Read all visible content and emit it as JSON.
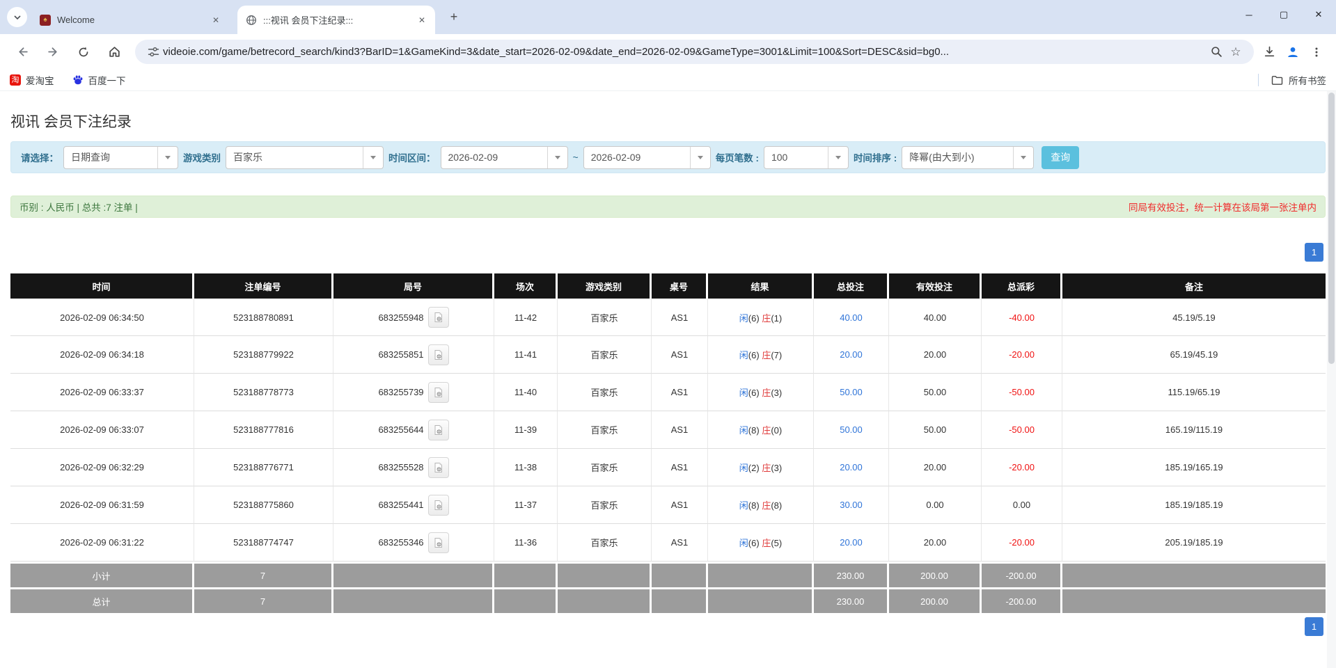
{
  "browser": {
    "tabs": [
      {
        "title": "Welcome",
        "close_glyph": "✕"
      },
      {
        "title": ":::视讯 会员下注纪录:::",
        "close_glyph": "✕"
      }
    ],
    "new_tab_glyph": "+",
    "window_controls": {
      "minimize": "─",
      "maximize": "▢",
      "close": "✕"
    },
    "url": "videoie.com/game/betrecord_search/kind3?BarID=1&GameKind=3&date_start=2026-02-09&date_end=2026-02-09&GameType=3001&Limit=100&Sort=DESC&sid=bg0...",
    "bookmarks": [
      {
        "label": "爱淘宝",
        "icon_text": "淘"
      },
      {
        "label": "百度一下"
      }
    ],
    "bookmarks_right_label": "所有书签"
  },
  "page": {
    "title": "视讯 会员下注纪录",
    "filters": {
      "select_label": "请选择：",
      "select_value": "日期查询",
      "game_label": "游戏类别",
      "game_value": "百家乐",
      "range_label": "时间区间：",
      "date_start": "2026-02-09",
      "tilde": "~",
      "date_end": "2026-02-09",
      "per_page_label": "每页笔数 :",
      "per_page_value": "100",
      "sort_label": "时间排序 :",
      "sort_value": "降幂(由大到小)",
      "search_button": "查询"
    },
    "summary": {
      "left": "币别 : 人民币 | 总共 :7 注单 |",
      "right": "同局有效投注，统一计算在该局第一张注单内"
    },
    "pagination_label": "1",
    "table": {
      "headers": [
        "时间",
        "注单编号",
        "局号",
        "场次",
        "游戏类别",
        "桌号",
        "结果",
        "总投注",
        "有效投注",
        "总派彩",
        "备注"
      ],
      "rows": [
        {
          "time": "2026-02-09 06:34:50",
          "bet_no": "523188780891",
          "round_no": "683255948",
          "session": "11-42",
          "game": "百家乐",
          "table_no": "AS1",
          "result": {
            "player_label": "闲",
            "player_score": "(6)",
            "banker_label": "庄",
            "banker_score": "(1)"
          },
          "total_bet": "40.00",
          "valid_bet": "40.00",
          "payout": "-40.00",
          "payout_neg": true,
          "note": "45.19/5.19"
        },
        {
          "time": "2026-02-09 06:34:18",
          "bet_no": "523188779922",
          "round_no": "683255851",
          "session": "11-41",
          "game": "百家乐",
          "table_no": "AS1",
          "result": {
            "player_label": "闲",
            "player_score": "(6)",
            "banker_label": "庄",
            "banker_score": "(7)"
          },
          "total_bet": "20.00",
          "valid_bet": "20.00",
          "payout": "-20.00",
          "payout_neg": true,
          "note": "65.19/45.19"
        },
        {
          "time": "2026-02-09 06:33:37",
          "bet_no": "523188778773",
          "round_no": "683255739",
          "session": "11-40",
          "game": "百家乐",
          "table_no": "AS1",
          "result": {
            "player_label": "闲",
            "player_score": "(6)",
            "banker_label": "庄",
            "banker_score": "(3)"
          },
          "total_bet": "50.00",
          "valid_bet": "50.00",
          "payout": "-50.00",
          "payout_neg": true,
          "note": "115.19/65.19"
        },
        {
          "time": "2026-02-09 06:33:07",
          "bet_no": "523188777816",
          "round_no": "683255644",
          "session": "11-39",
          "game": "百家乐",
          "table_no": "AS1",
          "result": {
            "player_label": "闲",
            "player_score": "(8)",
            "banker_label": "庄",
            "banker_score": "(0)"
          },
          "total_bet": "50.00",
          "valid_bet": "50.00",
          "payout": "-50.00",
          "payout_neg": true,
          "note": "165.19/115.19"
        },
        {
          "time": "2026-02-09 06:32:29",
          "bet_no": "523188776771",
          "round_no": "683255528",
          "session": "11-38",
          "game": "百家乐",
          "table_no": "AS1",
          "result": {
            "player_label": "闲",
            "player_score": "(2)",
            "banker_label": "庄",
            "banker_score": "(3)"
          },
          "total_bet": "20.00",
          "valid_bet": "20.00",
          "payout": "-20.00",
          "payout_neg": true,
          "note": "185.19/165.19"
        },
        {
          "time": "2026-02-09 06:31:59",
          "bet_no": "523188775860",
          "round_no": "683255441",
          "session": "11-37",
          "game": "百家乐",
          "table_no": "AS1",
          "result": {
            "player_label": "闲",
            "player_score": "(8)",
            "banker_label": "庄",
            "banker_score": "(8)"
          },
          "total_bet": "30.00",
          "valid_bet": "0.00",
          "payout": "0.00",
          "payout_neg": false,
          "note": "185.19/185.19"
        },
        {
          "time": "2026-02-09 06:31:22",
          "bet_no": "523188774747",
          "round_no": "683255346",
          "session": "11-36",
          "game": "百家乐",
          "table_no": "AS1",
          "result": {
            "player_label": "闲",
            "player_score": "(6)",
            "banker_label": "庄",
            "banker_score": "(5)"
          },
          "total_bet": "20.00",
          "valid_bet": "20.00",
          "payout": "-20.00",
          "payout_neg": true,
          "note": "205.19/185.19"
        }
      ],
      "subtotal": {
        "label": "小计",
        "count": "7",
        "total_bet": "230.00",
        "valid_bet": "200.00",
        "payout": "-200.00"
      },
      "total": {
        "label": "总计",
        "count": "7",
        "total_bet": "230.00",
        "valid_bet": "200.00",
        "payout": "-200.00"
      }
    }
  },
  "colors": {
    "tabstrip_bg": "#d8e2f3",
    "filter_bg": "#d9edf7",
    "filter_label": "#31708f",
    "summary_bg": "#dff0d8",
    "summary_text": "#3c763d",
    "alert_red": "#f02b2b",
    "table_header_bg": "#151515",
    "table_footer_bg": "#9c9c9c",
    "link_blue": "#2f74d8",
    "banker_red": "#e03b3b",
    "payout_red": "#f01212",
    "button_cyan": "#5bc0de",
    "pager_blue": "#3a7bd5",
    "profile_blue": "#1a73e8"
  }
}
